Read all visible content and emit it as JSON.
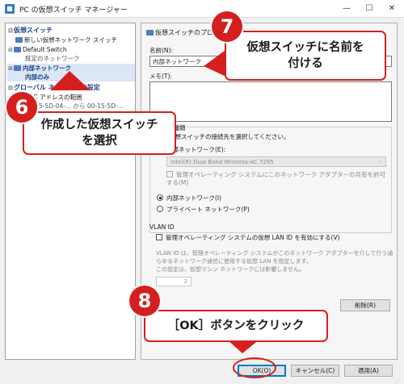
{
  "window": {
    "title": "PC の仮想スイッチ マネージャー",
    "controls": {
      "minimize": "—",
      "maximize": "☐",
      "close": "✕"
    }
  },
  "tree": {
    "virtual_switches_header": "仮想スイッチ",
    "new_switch": "新しい仮想ネットワーク スイッチ",
    "default_switch": "Default Switch",
    "default_switch_sub": "既定のネットワーク",
    "internal_network": "内部ネットワーク",
    "internal_network_sub": "内部のみ",
    "global_settings_header": "グローバル ネットワーク設定",
    "mac_range": "MAC アドレスの範囲",
    "mac_range_sub": "00-15-5D-04-... から 00-15-5D-..."
  },
  "props": {
    "section_title": "仮想スイッチのプロパティ",
    "name_label": "名前(N):",
    "name_value": "内部ネットワーク",
    "memo_label": "メモ(T):",
    "conn_type_label": "接続の種類",
    "conn_type_desc": "この仮想スイッチの接続先を選択してください。",
    "external_label": "外部ネットワーク(E):",
    "adapter_value": "Intel(R) Dual Band Wireless-AC 7265",
    "share_checkbox": "管理オペレーティング システムにこのネットワーク アダプターの共有を許可する(M)",
    "internal_radio": "内部ネットワーク(I)",
    "private_radio": "プライベート ネットワーク(P)",
    "vlan_title": "VLAN ID",
    "vlan_checkbox": "管理オペレーティング システムの仮想 LAN ID を有効にする(V)",
    "vlan_desc_1": "VLAN ID は、管理オペレーティング システムがこのネットワーク アダプターを介して行う通",
    "vlan_desc_2": "らゆるネットワーク通信に使用する仮想 LAN を指定します。",
    "vlan_desc_3": "この設定は、仮想マシン ネットワークには影響しません。",
    "vlan_value": "2",
    "remove_button": "削除(R)"
  },
  "footer": {
    "ok": "OK(O)",
    "cancel": "キャンセル(C)",
    "apply": "適用(A)"
  },
  "annotations": {
    "step6_number": "6",
    "step6_text_1": "作成した仮想スイッチ",
    "step6_text_2": "を選択",
    "step7_number": "7",
    "step7_text_1": "仮想スイッチに名前を",
    "step7_text_2": "付ける",
    "step8_number": "8",
    "step8_text": "［OK］ボタンをクリック"
  },
  "colors": {
    "accent_red": "#d51f1f",
    "selection_blue": "#dbe6f6",
    "section_blue": "#1c3f87"
  }
}
